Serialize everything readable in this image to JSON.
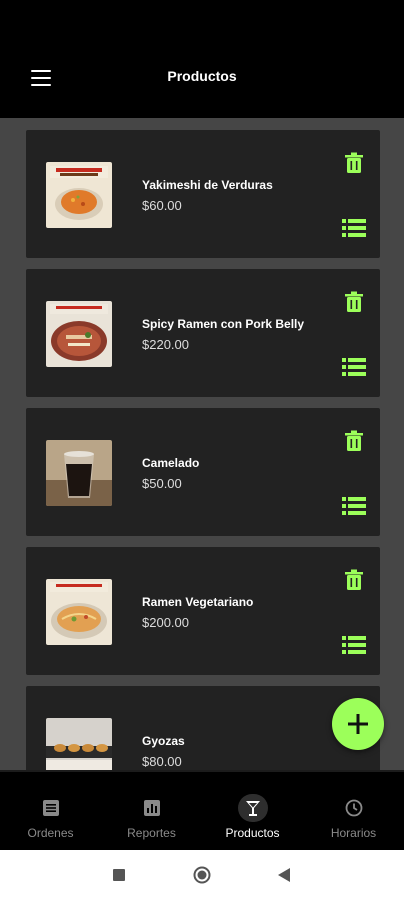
{
  "header": {
    "title": "Productos"
  },
  "products": [
    {
      "name": "Yakimeshi de Verduras",
      "price": "$60.00"
    },
    {
      "name": "Spicy Ramen con Pork Belly",
      "price": "$220.00"
    },
    {
      "name": "Camelado",
      "price": "$50.00"
    },
    {
      "name": "Ramen Vegetariano",
      "price": "$200.00"
    },
    {
      "name": "Gyozas",
      "price": "$80.00"
    }
  ],
  "bottom_nav": {
    "items": [
      {
        "label": "Ordenes",
        "icon": "receipt-icon"
      },
      {
        "label": "Reportes",
        "icon": "report-icon"
      },
      {
        "label": "Productos",
        "icon": "cocktail-icon"
      },
      {
        "label": "Horarios",
        "icon": "clock-icon"
      }
    ],
    "active": "Productos"
  },
  "colors": {
    "accent": "#9cff5a",
    "background": "#464646",
    "card": "#222222"
  }
}
